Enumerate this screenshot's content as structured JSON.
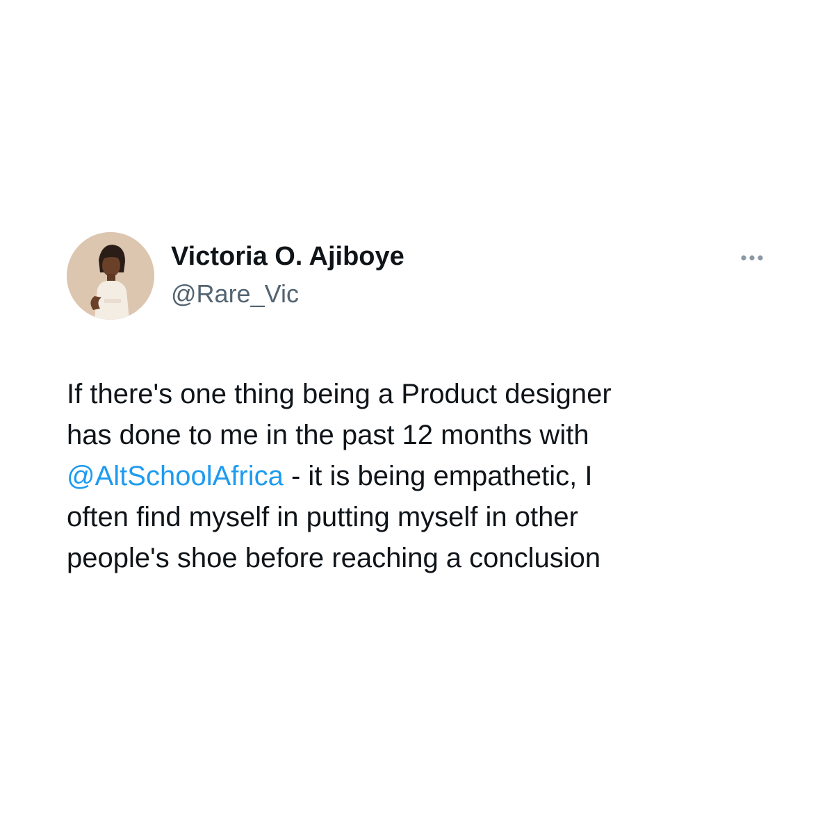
{
  "author": {
    "display_name": "Victoria O. Ajiboye",
    "handle": "@Rare_Vic",
    "avatar_icon": "profile-photo"
  },
  "more_menu": {
    "icon": "more-dots-icon"
  },
  "tweet": {
    "line1": "If there's one thing being a Product designer",
    "line2": "has done to me in the past 12 months with",
    "mention": "@AltSchoolAfrica",
    "line3_rest": " - it is being empathetic, I",
    "line4": "often find myself in putting myself in other",
    "line5": "people's shoe before reaching a conclusion"
  },
  "colors": {
    "background": "#ffffff",
    "text": "#0f1419",
    "secondary_text": "#536471",
    "mention": "#1d9bf0"
  }
}
